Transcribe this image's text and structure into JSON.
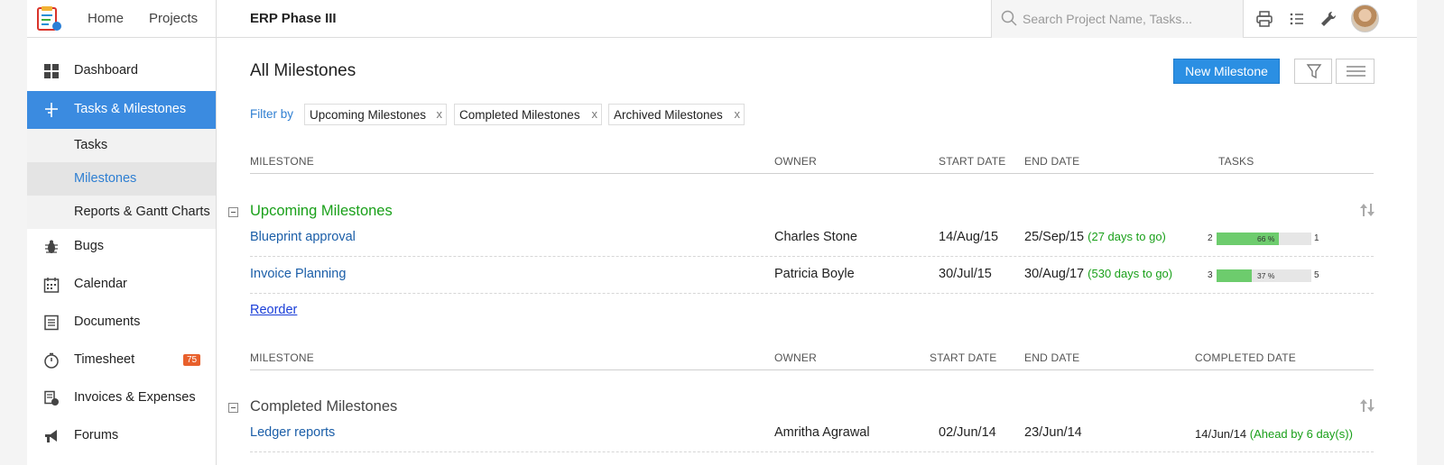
{
  "topbar": {
    "nav": [
      "Home",
      "Projects"
    ],
    "project_title": "ERP Phase III",
    "search_placeholder": "Search Project Name, Tasks..."
  },
  "sidebar": {
    "items": [
      {
        "label": "Dashboard",
        "icon": "dashboard-icon"
      },
      {
        "label": "Tasks & Milestones",
        "icon": "tasks-milestones-icon",
        "active": true
      },
      {
        "label": "Bugs",
        "icon": "bug-icon"
      },
      {
        "label": "Calendar",
        "icon": "calendar-icon"
      },
      {
        "label": "Documents",
        "icon": "documents-icon"
      },
      {
        "label": "Timesheet",
        "icon": "stopwatch-icon",
        "badge": "75"
      },
      {
        "label": "Invoices & Expenses",
        "icon": "invoice-icon"
      },
      {
        "label": "Forums",
        "icon": "megaphone-icon"
      }
    ],
    "sub_items": [
      {
        "label": "Tasks"
      },
      {
        "label": "Milestones",
        "selected": true
      },
      {
        "label": "Reports & Gantt Charts"
      }
    ]
  },
  "main": {
    "title": "All Milestones",
    "new_button": "New Milestone",
    "filter_label": "Filter by",
    "filters": [
      "Upcoming Milestones",
      "Completed Milestones",
      "Archived Milestones"
    ],
    "filter_remove": "x",
    "upcoming": {
      "headers": [
        "MILESTONE",
        "OWNER",
        "START DATE",
        "END DATE",
        "TASKS"
      ],
      "title": "Upcoming Milestones",
      "rows": [
        {
          "name": "Blueprint approval",
          "owner": "Charles Stone",
          "start": "14/Aug/15",
          "end": "25/Sep/15",
          "remaining": "(27 days to go)",
          "open": "2",
          "closed": "1",
          "percent_label": "66 %",
          "percent": 66
        },
        {
          "name": "Invoice Planning",
          "owner": "Patricia Boyle",
          "start": "30/Jul/15",
          "end": "30/Aug/17",
          "remaining": "(530 days to go)",
          "open": "3",
          "closed": "5",
          "percent_label": "37 %",
          "percent": 37
        }
      ],
      "reorder": "Reorder"
    },
    "completed": {
      "headers": [
        "MILESTONE",
        "OWNER",
        "START DATE",
        "END DATE",
        "COMPLETED DATE"
      ],
      "title": "Completed Milestones",
      "rows": [
        {
          "name": "Ledger reports",
          "owner": "Amritha Agrawal",
          "start": "02/Jun/14",
          "end": "23/Jun/14",
          "completed": "14/Jun/14",
          "note": "(Ahead by 6 day(s))"
        }
      ]
    }
  },
  "colors": {
    "accent": "#3b8be0",
    "button": "#2b8fe3",
    "upcoming_title": "#1aa01a",
    "badge": "#e8602c",
    "progress": "#6dcc6d"
  }
}
